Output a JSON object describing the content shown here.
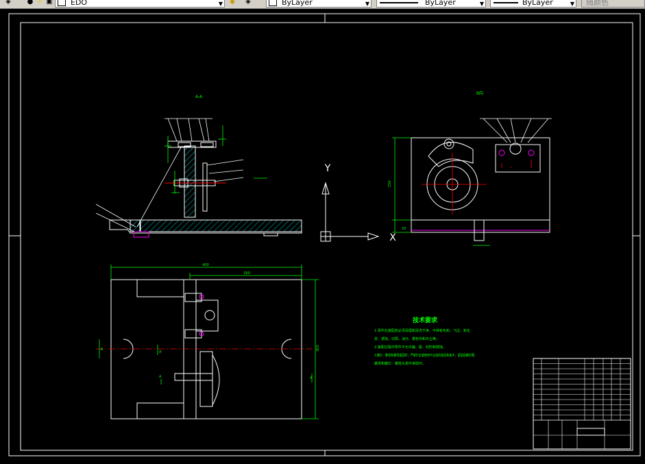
{
  "toolbar": {
    "layer_name": "EDO",
    "color_value": "ByLayer",
    "linetype_value": "ByLayer",
    "lineweight_value": "ByLayer",
    "plotstyle_value": "随颜色"
  },
  "drawing": {
    "background": "#000000",
    "colors": {
      "outline": "#ffffff",
      "hatch": "#00c0c0",
      "dimension": "#00ff00",
      "centerline": "#ff0000",
      "hole": "#ff00ff",
      "ucs": "#ffffff"
    },
    "view_labels": {
      "front": "A-A",
      "side": "B向"
    },
    "dimensions": {
      "top_overall": "400",
      "top_partial": "260",
      "top_height": "303",
      "side_height": "150",
      "side_base": "20"
    },
    "section_marks": [
      "A",
      "A",
      "A",
      "A"
    ],
    "ucs": {
      "y_label": "Y",
      "x_label": "X"
    },
    "notes": {
      "title": "技术要求",
      "lines": [
        "1.零件在装配前必须清理和清洗干净，不得有毛刺、飞边、氧化",
        "皮、锈蚀、切屑、油污、着色剂和灰尘等。",
        "2.装配过程中零件不允许磕、碰、划伤和锈蚀。",
        "3.螺钉、螺栓和螺母紧固时，严禁打击或使用不合适的旋具和扳手，紧固后螺钉槽、",
        "螺母和螺钉、螺栓头部不得损坏。"
      ]
    }
  }
}
